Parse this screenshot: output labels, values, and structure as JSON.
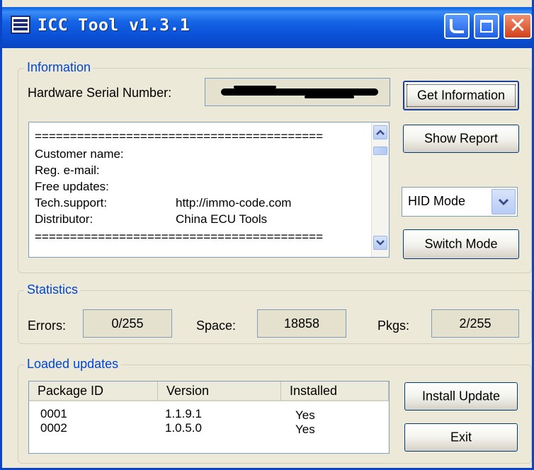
{
  "window": {
    "title": "ICC Tool v1.3.1",
    "icons": [
      "app-icon",
      "minimize-icon",
      "maximize-icon",
      "close-icon"
    ]
  },
  "information": {
    "legend": "Information",
    "serial_label": "Hardware Serial Number:",
    "get_info_button": "Get Information",
    "show_report_button": "Show Report",
    "switch_mode_button": "Switch Mode",
    "mode_select": {
      "selected": "HID Mode"
    },
    "report": {
      "separator": "=========================================",
      "lines": [
        {
          "key": "Customer name:",
          "value": ""
        },
        {
          "key": "Reg. e-mail:",
          "value": ""
        },
        {
          "key": "Free updates:",
          "value": ""
        },
        {
          "key": "Tech.support:",
          "value": "http://immo-code.com"
        },
        {
          "key": "Distributor:",
          "value": "China ECU Tools"
        }
      ]
    }
  },
  "statistics": {
    "legend": "Statistics",
    "errors_label": "Errors:",
    "errors_value": "0/255",
    "space_label": "Space:",
    "space_value": "18858",
    "pkgs_label": "Pkgs:",
    "pkgs_value": "2/255"
  },
  "updates": {
    "legend": "Loaded updates",
    "columns": [
      "Package ID",
      "Version",
      "Installed"
    ],
    "rows": [
      [
        "0001",
        "1.1.9.1",
        "Yes"
      ],
      [
        "0002",
        "1.0.5.0",
        "Yes"
      ]
    ],
    "install_button": "Install Update",
    "exit_button": "Exit"
  },
  "colors": {
    "title_bar": "#0a50d6",
    "legend_text": "#0046d5",
    "window_bg": "#ece9d8"
  }
}
